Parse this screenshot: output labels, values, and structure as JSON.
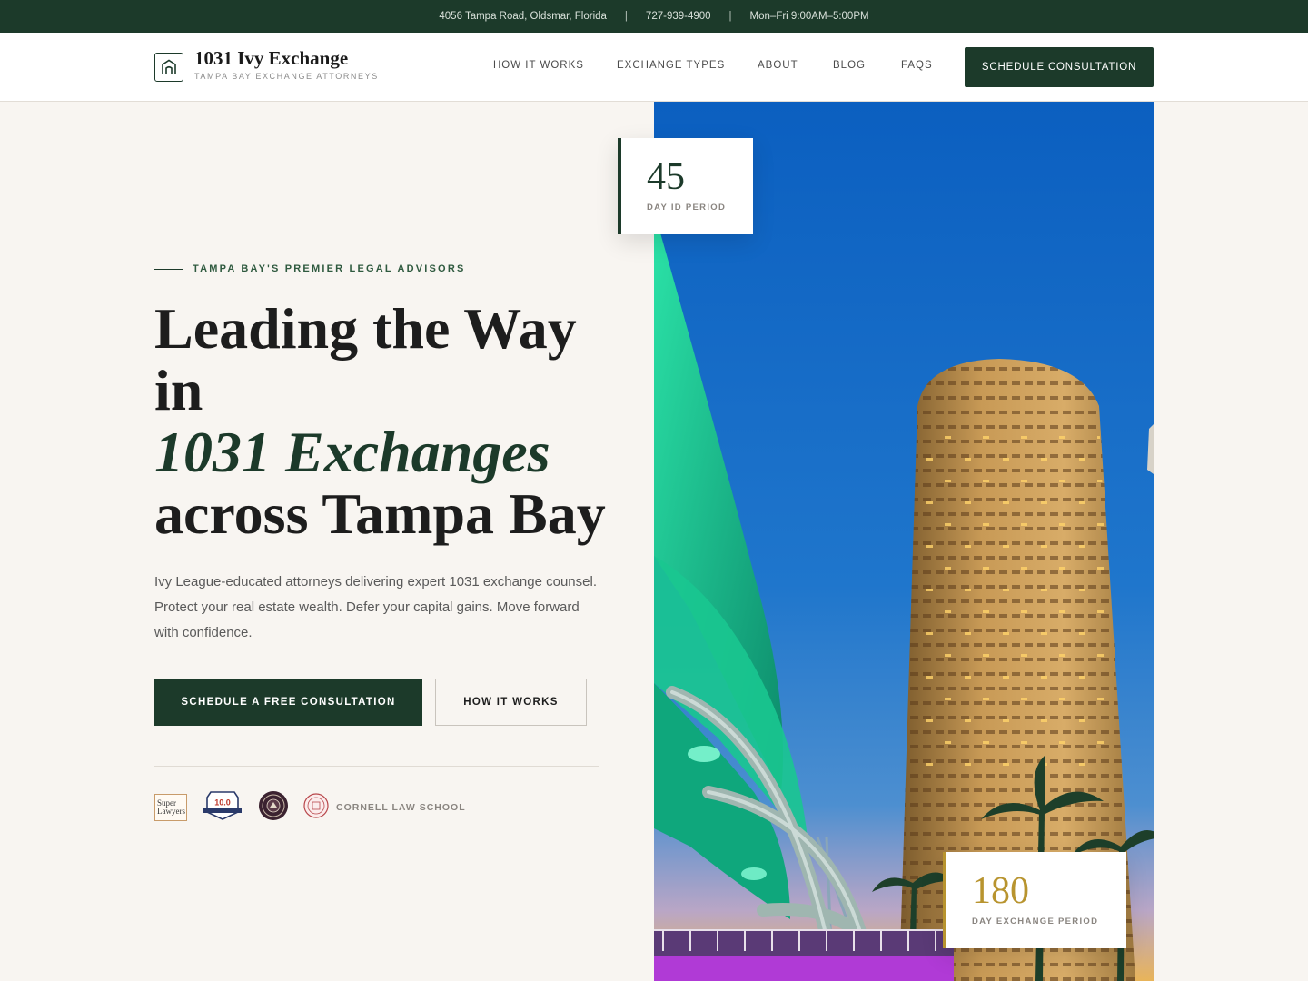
{
  "topbar": {
    "address": "4056 Tampa Road, Oldsmar, Florida",
    "phone": "727-939-4900",
    "hours": "Mon–Fri 9:00AM–5:00PM",
    "separator": "|"
  },
  "brand": {
    "name": "1031 Ivy Exchange",
    "tagline": "TAMPA BAY EXCHANGE ATTORNEYS"
  },
  "nav": {
    "items": [
      "HOW IT WORKS",
      "EXCHANGE TYPES",
      "ABOUT",
      "BLOG",
      "FAQS"
    ],
    "cta": "SCHEDULE CONSULTATION"
  },
  "hero": {
    "eyebrow": "TAMPA BAY'S PREMIER LEGAL ADVISORS",
    "headline_line1": "Leading the Way",
    "headline_line2": "in",
    "headline_emphasis": "1031 Exchanges",
    "headline_line4": "across Tampa Bay",
    "lede": "Ivy League-educated attorneys delivering expert 1031 exchange counsel. Protect your real estate wealth. Defer your capital gains. Move forward with confidence.",
    "primary_button": "SCHEDULE A FREE CONSULTATION",
    "secondary_button": "HOW IT WORKS"
  },
  "credentials": {
    "super_lawyers_1": "Super",
    "super_lawyers_2": "Lawyers",
    "avvo_rating": "10.0",
    "cornell": "CORNELL LAW SCHOOL"
  },
  "stats": [
    {
      "value": "45",
      "label": "DAY ID PERIOD"
    },
    {
      "value": "180",
      "label": "DAY EXCHANGE PERIOD"
    }
  ],
  "colors": {
    "brand_green": "#1c3a2a",
    "gold": "#b8942f",
    "background": "#f8f5f1"
  }
}
